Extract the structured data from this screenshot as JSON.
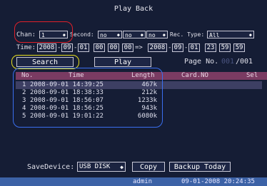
{
  "title": "Play Back",
  "filters": {
    "chan_label": "Chan:",
    "chan_value": "1",
    "second_label": "Second:",
    "second_values": [
      "no",
      "no",
      "no"
    ],
    "rec_type_label": "Rec. Type:",
    "rec_type_value": "All"
  },
  "time": {
    "label": "Time:",
    "start": {
      "year": "2008",
      "month": "09",
      "day": "01",
      "hour": "00",
      "minute": "00",
      "second": "00"
    },
    "arrow": "=>",
    "end": {
      "year": "2008",
      "month": "09",
      "day": "01",
      "hour": "23",
      "minute": "59",
      "second": "59"
    }
  },
  "actions": {
    "search_label": "Search",
    "play_label": "Play",
    "page_label": "Page No.",
    "page_current": "001",
    "page_total": "/001"
  },
  "table": {
    "headers": {
      "no": "No.",
      "time": "Time",
      "length": "Length",
      "card": "Card.NO",
      "sel": "Sel"
    },
    "rows": [
      {
        "no": "1",
        "time": "2008-09-01 14:39:25",
        "length": "467k",
        "selected": true
      },
      {
        "no": "2",
        "time": "2008-09-01 18:38:33",
        "length": "212k",
        "selected": false
      },
      {
        "no": "3",
        "time": "2008-09-01 18:56:07",
        "length": "1233k",
        "selected": false
      },
      {
        "no": "4",
        "time": "2008-09-01 18:56:25",
        "length": "943k",
        "selected": false
      },
      {
        "no": "5",
        "time": "2008-09-01 19:01:22",
        "length": "6080k",
        "selected": false
      }
    ]
  },
  "save": {
    "device_label": "SaveDevice:",
    "device_value": "USB DISK",
    "copy_label": "Copy",
    "backup_label": "Backup Today"
  },
  "status": {
    "user": "admin",
    "datetime": "09-01-2008 20:24:35"
  },
  "colors": {
    "background": "#151d35",
    "header_bar": "#7a3b62",
    "status_bar": "#3c62a6",
    "highlight_red": "#e0202a",
    "highlight_yellow": "#e8e020",
    "highlight_blue": "#3a6ff0"
  }
}
